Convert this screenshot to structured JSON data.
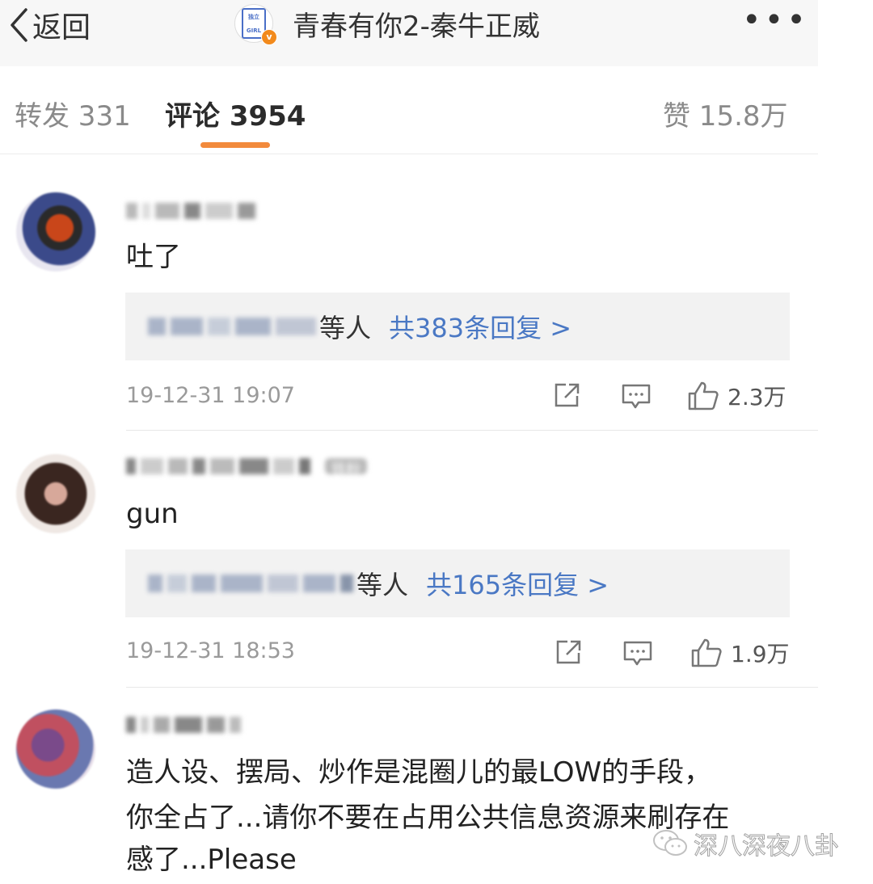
{
  "topbar": {
    "back_label": "返回",
    "title": "青春有你2-秦牛正威",
    "more_label": "•••"
  },
  "tabs": {
    "repost": "转发 331",
    "comments": "评论 3954",
    "likes": "赞 15.8万"
  },
  "comments": [
    {
      "text": "吐了",
      "reply_who": "等人",
      "reply_count": "共383条回复 >",
      "timestamp": "19-12-31 19:07",
      "likes": "2.3万"
    },
    {
      "badge": "铁粉",
      "text": "gun",
      "reply_who": "等人",
      "reply_count": "共165条回复 >",
      "timestamp": "19-12-31 18:53",
      "likes": "1.9万"
    },
    {
      "text_lines": [
        "造人设、摆局、炒作是混圈儿的最LOW的手段，",
        "你全占了...请你不要在占用公共信息资源来刷存在",
        "感了...Please"
      ]
    }
  ],
  "watermark": "深八深夜八卦",
  "colors": {
    "accent_underline": "#f28a3c",
    "link_blue": "#4a78c4",
    "verified_badge": "#f28a1c",
    "fan_badge": "#7aa3e8"
  },
  "icons": [
    "chevron-left-icon",
    "more-dots-icon",
    "share-icon",
    "comment-icon",
    "thumbs-up-icon",
    "verified-icon",
    "wechat-icon"
  ]
}
